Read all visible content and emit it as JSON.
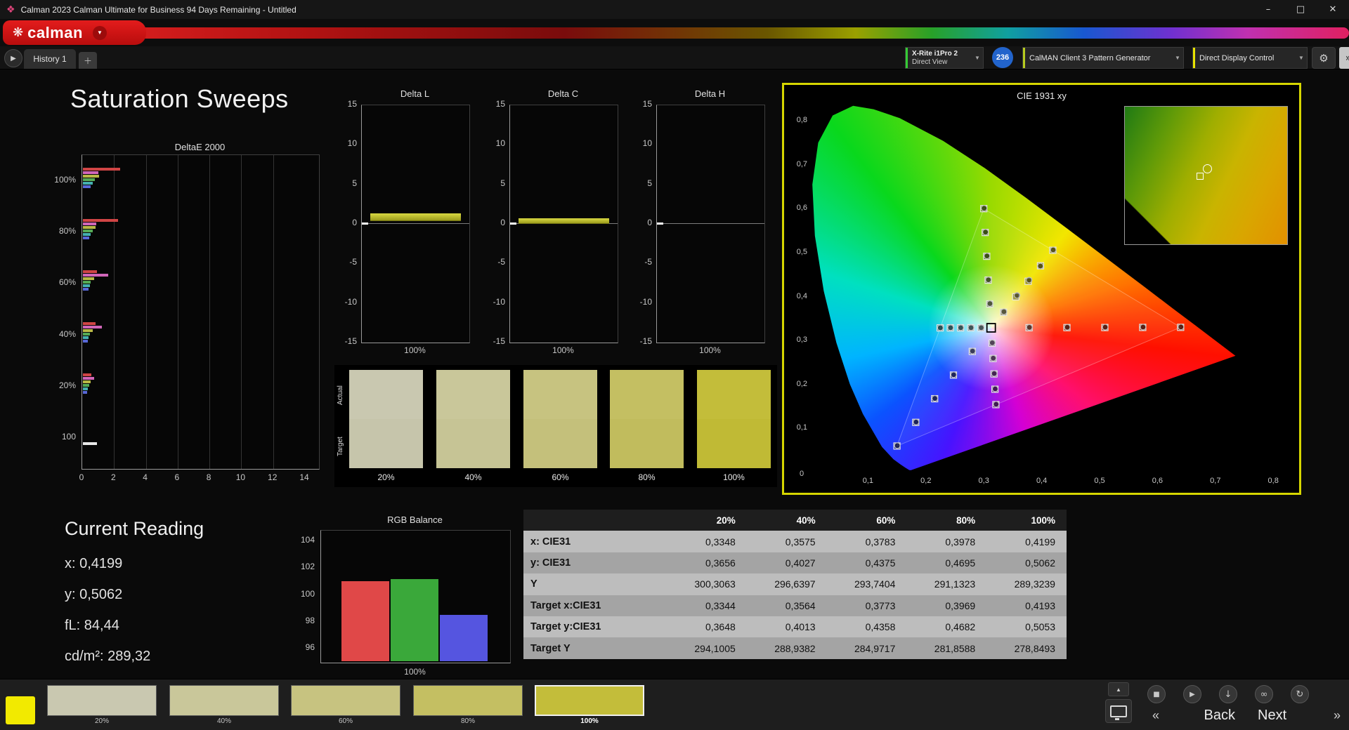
{
  "window": {
    "title": "Calman 2023 Calman Ultimate for Business 94 Days Remaining  - Untitled"
  },
  "icons": {
    "app": "❖",
    "flower": "❋",
    "caret": "▼",
    "play": "▶",
    "plus": "＋",
    "gear": "⚙",
    "min": "–",
    "max": "□",
    "close": "✕",
    "collapse": "▲",
    "stop": "■",
    "save": "↓",
    "link": "∞",
    "refresh": "↻",
    "back_chev": "«",
    "next_chev": "»"
  },
  "logo": {
    "text": "calman"
  },
  "tab_bar": {
    "tab": "History 1"
  },
  "toolbar": {
    "meter_line1": "X-Rite i1Pro 2",
    "meter_line2": "Direct View",
    "badge": "236",
    "pattern_gen": "CalMAN Client 3 Pattern Generator",
    "display_ctrl": "Direct Display Control"
  },
  "page_title": "Saturation Sweeps",
  "charts": {
    "deltaE": {
      "title": "DeltaE 2000",
      "x_ticks": [
        "0",
        "2",
        "4",
        "6",
        "8",
        "10",
        "12",
        "14"
      ],
      "x_max": 14,
      "groups": [
        {
          "label": "100%",
          "bars": [
            {
              "c": "#d04545",
              "v": 2.35
            },
            {
              "c": "#d066b8",
              "v": 0.95
            },
            {
              "c": "#b8b845",
              "v": 1.0
            },
            {
              "c": "#55aa55",
              "v": 0.75
            },
            {
              "c": "#45b0b0",
              "v": 0.6
            },
            {
              "c": "#5868d8",
              "v": 0.5
            }
          ]
        },
        {
          "label": "80%",
          "bars": [
            {
              "c": "#d04545",
              "v": 2.2
            },
            {
              "c": "#d066b8",
              "v": 0.85
            },
            {
              "c": "#b8b845",
              "v": 0.8
            },
            {
              "c": "#55aa55",
              "v": 0.6
            },
            {
              "c": "#45b0b0",
              "v": 0.5
            },
            {
              "c": "#5868d8",
              "v": 0.4
            }
          ]
        },
        {
          "label": "60%",
          "bars": [
            {
              "c": "#d04545",
              "v": 0.9
            },
            {
              "c": "#d066b8",
              "v": 1.6
            },
            {
              "c": "#b8b845",
              "v": 0.7
            },
            {
              "c": "#55aa55",
              "v": 0.5
            },
            {
              "c": "#45b0b0",
              "v": 0.45
            },
            {
              "c": "#5868d8",
              "v": 0.35
            }
          ]
        },
        {
          "label": "40%",
          "bars": [
            {
              "c": "#d04545",
              "v": 0.8
            },
            {
              "c": "#d066b8",
              "v": 1.2
            },
            {
              "c": "#b8b845",
              "v": 0.6
            },
            {
              "c": "#55aa55",
              "v": 0.45
            },
            {
              "c": "#45b0b0",
              "v": 0.35
            },
            {
              "c": "#5868d8",
              "v": 0.3
            }
          ]
        },
        {
          "label": "20%",
          "bars": [
            {
              "c": "#d04545",
              "v": 0.55
            },
            {
              "c": "#d066b8",
              "v": 0.7
            },
            {
              "c": "#b8b845",
              "v": 0.5
            },
            {
              "c": "#55aa55",
              "v": 0.4
            },
            {
              "c": "#45b0b0",
              "v": 0.3
            },
            {
              "c": "#5868d8",
              "v": 0.25
            }
          ]
        },
        {
          "label": "100",
          "bars": [
            {
              "c": "#e8e8e8",
              "v": 0.9
            }
          ]
        }
      ]
    },
    "deltaL": {
      "title": "Delta L",
      "y_ticks": [
        "15",
        "10",
        "5",
        "0",
        "-5",
        "-10",
        "-15"
      ],
      "range": 15,
      "value": 0.9,
      "x_label": "100%"
    },
    "deltaC": {
      "title": "Delta C",
      "y_ticks": [
        "15",
        "10",
        "5",
        "0",
        "-5",
        "-10",
        "-15"
      ],
      "range": 15,
      "value": 0.4,
      "x_label": "100%"
    },
    "deltaH": {
      "title": "Delta H",
      "y_ticks": [
        "15",
        "10",
        "5",
        "0",
        "-5",
        "-10",
        "-15"
      ],
      "range": 15,
      "value": 0.0,
      "x_label": "100%"
    },
    "rgb": {
      "title": "RGB Balance",
      "y_ticks": [
        "104",
        "102",
        "100",
        "98",
        "96"
      ],
      "bars": [
        {
          "c": "#e04848",
          "v": 101.0
        },
        {
          "c": "#3aa83a",
          "v": 101.2
        },
        {
          "c": "#5555e0",
          "v": 98.5
        }
      ],
      "x_label": "100%"
    },
    "cie": {
      "title": "CIE 1931 xy",
      "x_ticks": [
        "0,1",
        "0,2",
        "0,3",
        "0,4",
        "0,5",
        "0,6",
        "0,7",
        "0,8"
      ],
      "y_ticks": [
        "0,1",
        "0,2",
        "0,3",
        "0,4",
        "0,5",
        "0,6",
        "0,7",
        "0,8"
      ],
      "origin": "0",
      "white_point": [
        0.3127,
        0.329
      ],
      "gamut_triangle": [
        [
          0.64,
          0.33
        ],
        [
          0.3,
          0.6
        ],
        [
          0.15,
          0.06
        ]
      ],
      "targets": [
        [
          0.3782,
          0.3292
        ],
        [
          0.4436,
          0.3294
        ],
        [
          0.5091,
          0.3296
        ],
        [
          0.5745,
          0.3298
        ],
        [
          0.64,
          0.33
        ],
        [
          0.3102,
          0.3832
        ],
        [
          0.3076,
          0.4374
        ],
        [
          0.3051,
          0.4916
        ],
        [
          0.3025,
          0.5458
        ],
        [
          0.3,
          0.6
        ],
        [
          0.2802,
          0.2752
        ],
        [
          0.2476,
          0.2214
        ],
        [
          0.2151,
          0.1676
        ],
        [
          0.1825,
          0.1138
        ],
        [
          0.15,
          0.06
        ],
        [
          0.2951,
          0.3289
        ],
        [
          0.2775,
          0.3289
        ],
        [
          0.2598,
          0.3288
        ],
        [
          0.2422,
          0.3288
        ],
        [
          0.2246,
          0.3287
        ],
        [
          0.3143,
          0.294
        ],
        [
          0.316,
          0.2591
        ],
        [
          0.3176,
          0.2241
        ],
        [
          0.3193,
          0.1892
        ],
        [
          0.3209,
          0.1542
        ],
        [
          0.334,
          0.3643
        ],
        [
          0.3553,
          0.3995
        ],
        [
          0.3766,
          0.4348
        ],
        [
          0.398,
          0.47
        ],
        [
          0.4193,
          0.5053
        ]
      ],
      "measured": [
        [
          0.3788,
          0.33
        ],
        [
          0.4442,
          0.3302
        ],
        [
          0.5097,
          0.3304
        ],
        [
          0.5751,
          0.3306
        ],
        [
          0.6405,
          0.3308
        ],
        [
          0.3106,
          0.384
        ],
        [
          0.308,
          0.4381
        ],
        [
          0.3055,
          0.4924
        ],
        [
          0.303,
          0.5466
        ],
        [
          0.3006,
          0.6009
        ],
        [
          0.2806,
          0.276
        ],
        [
          0.248,
          0.2222
        ],
        [
          0.2155,
          0.1684
        ],
        [
          0.183,
          0.1146
        ],
        [
          0.1506,
          0.061
        ],
        [
          0.2955,
          0.3292
        ],
        [
          0.2779,
          0.3292
        ],
        [
          0.2602,
          0.3291
        ],
        [
          0.2426,
          0.3291
        ],
        [
          0.225,
          0.329
        ],
        [
          0.3147,
          0.2948
        ],
        [
          0.3164,
          0.2599
        ],
        [
          0.318,
          0.2249
        ],
        [
          0.3197,
          0.19
        ],
        [
          0.3213,
          0.155
        ],
        [
          0.3348,
          0.3656
        ],
        [
          0.3575,
          0.4027
        ],
        [
          0.3783,
          0.4375
        ],
        [
          0.3978,
          0.4695
        ],
        [
          0.4199,
          0.5062
        ]
      ]
    }
  },
  "swatches": {
    "row_labels": [
      "Actual",
      "Target"
    ],
    "items": [
      {
        "label": "20%",
        "actual": "#c9c8b0",
        "target": "#c6c5ab"
      },
      {
        "label": "40%",
        "actual": "#c9c79a",
        "target": "#c6c495"
      },
      {
        "label": "60%",
        "actual": "#c7c380",
        "target": "#c4c07b"
      },
      {
        "label": "80%",
        "actual": "#c4bf62",
        "target": "#c1bc5d"
      },
      {
        "label": "100%",
        "actual": "#c3bd3a",
        "target": "#c0ba35"
      }
    ]
  },
  "current_reading": {
    "title": "Current Reading",
    "lines": [
      "x: 0,4199",
      "y: 0,5062",
      "fL: 84,44",
      "cd/m²: 289,32"
    ]
  },
  "data_table": {
    "columns": [
      "20%",
      "40%",
      "60%",
      "80%",
      "100%"
    ],
    "rows": [
      {
        "label": "x: CIE31",
        "values": [
          "0,3348",
          "0,3575",
          "0,3783",
          "0,3978",
          "0,4199"
        ]
      },
      {
        "label": "y: CIE31",
        "values": [
          "0,3656",
          "0,4027",
          "0,4375",
          "0,4695",
          "0,5062"
        ]
      },
      {
        "label": "Y",
        "values": [
          "300,3063",
          "296,6397",
          "293,7404",
          "291,1323",
          "289,3239"
        ]
      },
      {
        "label": "Target x:CIE31",
        "values": [
          "0,3344",
          "0,3564",
          "0,3773",
          "0,3969",
          "0,4193"
        ]
      },
      {
        "label": "Target y:CIE31",
        "values": [
          "0,3648",
          "0,4013",
          "0,4358",
          "0,4682",
          "0,5053"
        ]
      },
      {
        "label": "Target Y",
        "values": [
          "294,1005",
          "288,9382",
          "284,9717",
          "281,8588",
          "278,8493"
        ]
      }
    ]
  },
  "bottom_bar": {
    "patches": [
      {
        "label": "20%",
        "color": "#c9c8b0",
        "selected": false
      },
      {
        "label": "40%",
        "color": "#c9c79a",
        "selected": false
      },
      {
        "label": "60%",
        "color": "#c7c380",
        "selected": false
      },
      {
        "label": "80%",
        "color": "#c4bf62",
        "selected": false
      },
      {
        "label": "100%",
        "color": "#c3bd3a",
        "selected": true
      }
    ],
    "back": "Back",
    "next": "Next"
  },
  "colors": {
    "accent_yellow": "#d6d600",
    "active_patch": "#f2ea00"
  }
}
